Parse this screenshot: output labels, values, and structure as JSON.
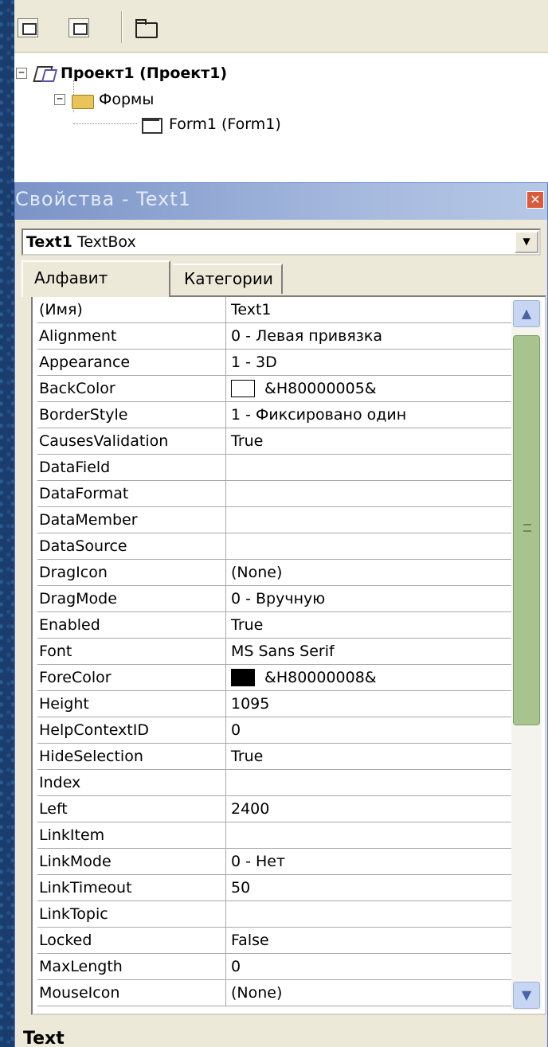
{
  "project_explorer": {
    "toolbar": {
      "view_code_icon": "view-code-icon",
      "view_object_icon": "view-object-icon",
      "toggle_folders_icon": "folder-icon"
    },
    "tree": {
      "project_label": "Проект1 (Проект1)",
      "forms_folder_label": "Формы",
      "form_label": "Form1 (Form1)",
      "collapse_glyph": "−"
    }
  },
  "properties": {
    "title": "Свойства - Text1",
    "close_glyph": "✕",
    "object_name": "Text1",
    "object_type": "TextBox",
    "dropdown_glyph": "▼",
    "tabs": [
      "Алфавит",
      "Категории"
    ],
    "rows": [
      {
        "name": "(Имя)",
        "value": "Text1"
      },
      {
        "name": "Alignment",
        "value": "0 - Левая привязка"
      },
      {
        "name": "Appearance",
        "value": "1 - 3D"
      },
      {
        "name": "BackColor",
        "value": "&H80000005&",
        "swatch": "#ffffff"
      },
      {
        "name": "BorderStyle",
        "value": "1 - Фиксировано один"
      },
      {
        "name": "CausesValidation",
        "value": "True"
      },
      {
        "name": "DataField",
        "value": ""
      },
      {
        "name": "DataFormat",
        "value": ""
      },
      {
        "name": "DataMember",
        "value": ""
      },
      {
        "name": "DataSource",
        "value": ""
      },
      {
        "name": "DragIcon",
        "value": "(None)"
      },
      {
        "name": "DragMode",
        "value": "0 - Вручную"
      },
      {
        "name": "Enabled",
        "value": "True"
      },
      {
        "name": "Font",
        "value": "MS Sans Serif"
      },
      {
        "name": "ForeColor",
        "value": "&H80000008&",
        "swatch": "#000000"
      },
      {
        "name": "Height",
        "value": "1095"
      },
      {
        "name": "HelpContextID",
        "value": "0"
      },
      {
        "name": "HideSelection",
        "value": "True"
      },
      {
        "name": "Index",
        "value": ""
      },
      {
        "name": "Left",
        "value": "2400"
      },
      {
        "name": "LinkItem",
        "value": ""
      },
      {
        "name": "LinkMode",
        "value": "0 - Нет"
      },
      {
        "name": "LinkTimeout",
        "value": "50"
      },
      {
        "name": "LinkTopic",
        "value": ""
      },
      {
        "name": "Locked",
        "value": "False"
      },
      {
        "name": "MaxLength",
        "value": "0"
      },
      {
        "name": "MouseIcon",
        "value": "(None)"
      }
    ],
    "scroll_up_glyph": "▲",
    "scroll_down_glyph": "▼",
    "description_title": "Text"
  }
}
